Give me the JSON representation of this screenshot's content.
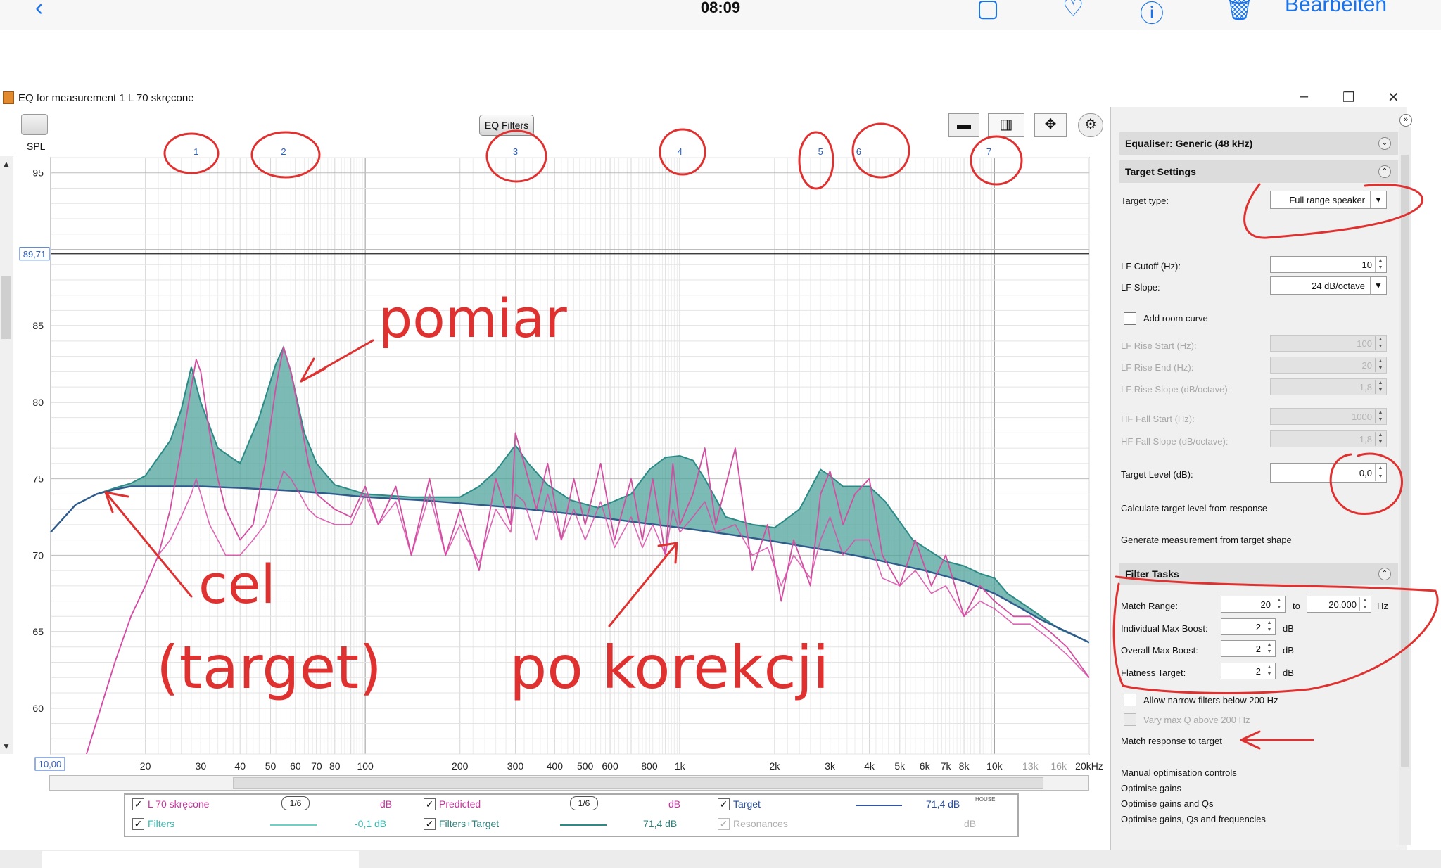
{
  "ios": {
    "time": "08:09",
    "edit_label": "Bearbeiten"
  },
  "window": {
    "title": "EQ for measurement 1 L 70 skręcone"
  },
  "toolbar": {
    "eq_filters": "EQ Filters",
    "spl_label": "SPL"
  },
  "chart": {
    "y_ticks": [
      "95",
      "85",
      "80",
      "75",
      "70",
      "65",
      "60"
    ],
    "x_ticks": [
      "20",
      "30",
      "40",
      "50",
      "60",
      "70",
      "80",
      "100",
      "200",
      "300",
      "400",
      "500",
      "600",
      "800",
      "1k",
      "2k",
      "3k",
      "4k",
      "5k",
      "6k",
      "7k",
      "8k",
      "10k",
      "13k",
      "16k",
      "20kHz"
    ],
    "cursor_y": "89,71",
    "cursor_x": "10,00",
    "filter_numbers": [
      "1",
      "2",
      "3",
      "4",
      "5",
      "6",
      "7"
    ]
  },
  "chart_data": {
    "type": "line",
    "xscale": "log",
    "xlim": [
      10,
      20000
    ],
    "ylim": [
      57,
      96
    ],
    "series": [
      {
        "name": "L 70 skręcone",
        "color": "#d24ea0",
        "x": [
          13,
          16,
          18,
          20,
          22,
          24,
          26,
          28,
          29,
          30,
          32,
          34,
          36,
          40,
          44,
          48,
          52,
          55,
          58,
          62,
          66,
          70,
          80,
          90,
          100,
          110,
          125,
          140,
          160,
          180,
          200,
          230,
          260,
          290,
          300,
          320,
          350,
          380,
          420,
          460,
          500,
          560,
          620,
          700,
          760,
          820,
          900,
          950,
          1000,
          1100,
          1200,
          1300,
          1500,
          1700,
          1900,
          2100,
          2300,
          2600,
          2800,
          3000,
          3300,
          3600,
          4000,
          4400,
          5000,
          5600,
          6300,
          7000,
          8000,
          9000,
          10000,
          11500,
          13000,
          15000,
          17000,
          20000
        ],
        "y": [
          57,
          63,
          66,
          68,
          70,
          73,
          77,
          81,
          82.8,
          82,
          78,
          75,
          73,
          71,
          72,
          76,
          81,
          83.6,
          82,
          79,
          76,
          74,
          73,
          72.5,
          74.5,
          72,
          74.5,
          70,
          75,
          70,
          73,
          69,
          75,
          72,
          78,
          76,
          73,
          76,
          71,
          75,
          72,
          76,
          71,
          75,
          71,
          75,
          70,
          76,
          72,
          74,
          77,
          72,
          77,
          69,
          72,
          67,
          71,
          68,
          74,
          75.5,
          72,
          74,
          75,
          70,
          68,
          71,
          68,
          70,
          66,
          68,
          67,
          66,
          66,
          65,
          64,
          62
        ]
      },
      {
        "name": "Predicted",
        "color": "#d84ba8",
        "x": [
          13,
          16,
          18,
          20,
          22,
          24,
          26,
          28,
          29,
          30,
          32,
          34,
          36,
          40,
          44,
          48,
          52,
          55,
          58,
          62,
          66,
          70,
          80,
          90,
          100,
          110,
          125,
          140,
          160,
          180,
          200,
          230,
          260,
          290,
          300,
          320,
          350,
          380,
          420,
          460,
          500,
          560,
          620,
          700,
          760,
          820,
          900,
          950,
          1000,
          1100,
          1200,
          1300,
          1500,
          1700,
          1900,
          2100,
          2300,
          2600,
          2800,
          3000,
          3300,
          3600,
          4000,
          4400,
          5000,
          5600,
          6300,
          7000,
          8000,
          9000,
          10000,
          11500,
          13000,
          15000,
          17000,
          20000
        ],
        "y": [
          57,
          63,
          66,
          68,
          70,
          71,
          72.5,
          74,
          75,
          74,
          72,
          71,
          70,
          70,
          71,
          72,
          74,
          75.5,
          75,
          74,
          73,
          72.5,
          72,
          72,
          74,
          72,
          73.5,
          70,
          74,
          70,
          72,
          69.5,
          73,
          71.5,
          74,
          73.5,
          71,
          74,
          71,
          73,
          71,
          73.5,
          70.5,
          72.5,
          70.5,
          72,
          70,
          73,
          71.5,
          72.5,
          73.5,
          71.5,
          72,
          70,
          70.5,
          68,
          70,
          68.5,
          71,
          72.5,
          70,
          71,
          71,
          68.5,
          68,
          69,
          67.5,
          68,
          66,
          67,
          66.5,
          65.5,
          65.5,
          64.5,
          63.5,
          62
        ]
      },
      {
        "name": "Target",
        "color": "#2f5b8c",
        "x": [
          10,
          12,
          14,
          16,
          18,
          20,
          25,
          30,
          40,
          60,
          80,
          100,
          150,
          200,
          300,
          500,
          700,
          1000,
          1500,
          2000,
          3000,
          4000,
          6000,
          8000,
          10000,
          12000,
          14000,
          17000,
          20000
        ],
        "y": [
          71.5,
          73.3,
          74.0,
          74.3,
          74.5,
          74.5,
          74.5,
          74.5,
          74.4,
          74.2,
          74.0,
          73.8,
          73.6,
          73.4,
          73.1,
          72.6,
          72.2,
          71.8,
          71.3,
          70.9,
          70.3,
          69.8,
          69.0,
          68.3,
          67.5,
          66.6,
          65.8,
          65.0,
          64.3
        ]
      },
      {
        "name": "Filters+Target",
        "color": "#2c8a86",
        "x": [
          10,
          12,
          14,
          16,
          18,
          20,
          24,
          26,
          28,
          30,
          34,
          40,
          46,
          52,
          55,
          58,
          64,
          70,
          80,
          100,
          140,
          200,
          230,
          260,
          300,
          330,
          380,
          450,
          550,
          700,
          800,
          900,
          1000,
          1100,
          1200,
          1400,
          1700,
          2000,
          2400,
          2800,
          3000,
          3300,
          4000,
          4500,
          5500,
          7000,
          8000,
          9000,
          10000,
          11000,
          13000,
          16000,
          20000
        ],
        "y": [
          71.5,
          73.3,
          74.0,
          74.4,
          74.7,
          75.2,
          77.5,
          79.5,
          82.3,
          80,
          77,
          76,
          79,
          82.5,
          83.6,
          82,
          78,
          76,
          74.6,
          74.0,
          73.8,
          73.8,
          74.5,
          75.5,
          77.2,
          76,
          74.6,
          73.6,
          73.1,
          74,
          75.6,
          76.4,
          76.5,
          76.2,
          75,
          72.5,
          72,
          71.8,
          73,
          75.6,
          75.2,
          74.5,
          74.5,
          73.5,
          71,
          69.6,
          69.3,
          68.8,
          68.5,
          67.5,
          66.5,
          65.2,
          64.3
        ]
      }
    ]
  },
  "legend": {
    "items": [
      {
        "name": "L 70 skręcone",
        "smoothing": "1/6",
        "value": "dB"
      },
      {
        "name": "Predicted",
        "smoothing": "1/6",
        "value": "dB"
      },
      {
        "name": "Target",
        "value": "71,4 dB",
        "note": "HOUSE"
      },
      {
        "name": "Filters",
        "value": "-0,1 dB"
      },
      {
        "name": "Filters+Target",
        "value": "71,4 dB"
      },
      {
        "name": "Resonances",
        "value": "dB"
      }
    ]
  },
  "panel": {
    "equaliser_header": "Equaliser: Generic (48 kHz)",
    "target_header": "Target Settings",
    "target_type_label": "Target type:",
    "target_type_value": "Full range speaker",
    "lf_cutoff_label": "LF Cutoff (Hz):",
    "lf_cutoff_value": "10",
    "lf_slope_label": "LF Slope:",
    "lf_slope_value": "24 dB/octave",
    "add_room_curve": "Add room curve",
    "lf_rise_start_label": "LF Rise Start (Hz):",
    "lf_rise_start_value": "100",
    "lf_rise_end_label": "LF Rise End (Hz):",
    "lf_rise_end_value": "20",
    "lf_rise_slope_label": "LF Rise Slope (dB/octave):",
    "lf_rise_slope_value": "1,8",
    "hf_fall_start_label": "HF Fall Start (Hz):",
    "hf_fall_start_value": "1000",
    "hf_fall_slope_label": "HF Fall Slope (dB/octave):",
    "hf_fall_slope_value": "1,8",
    "target_level_label": "Target Level (dB):",
    "target_level_value": "0,0",
    "calc_target": "Calculate target level from response",
    "gen_measurement": "Generate measurement from target shape",
    "filter_tasks_header": "Filter Tasks",
    "match_range_label": "Match Range:",
    "match_range_from": "20",
    "match_range_to_label": "to",
    "match_range_to": "20.000",
    "hz_unit": "Hz",
    "ind_max_boost_label": "Individual Max Boost:",
    "ind_max_boost_value": "2",
    "overall_max_boost_label": "Overall Max Boost:",
    "overall_max_boost_value": "2",
    "flatness_label": "Flatness Target:",
    "flatness_value": "2",
    "db_unit": "dB",
    "allow_narrow": "Allow narrow filters below 200 Hz",
    "vary_max_q": "Vary max Q above 200 Hz",
    "match_response": "Match response to target",
    "manual_controls": "Manual optimisation controls",
    "opt_gains": "Optimise gains",
    "opt_gains_qs": "Optimise gains and Qs",
    "opt_gains_qs_freq": "Optimise gains, Qs and frequencies"
  },
  "annotations": {
    "pomiar": "pomiar",
    "cel": "cel",
    "target": "(target)",
    "po_korekcji": "po korekcji"
  }
}
